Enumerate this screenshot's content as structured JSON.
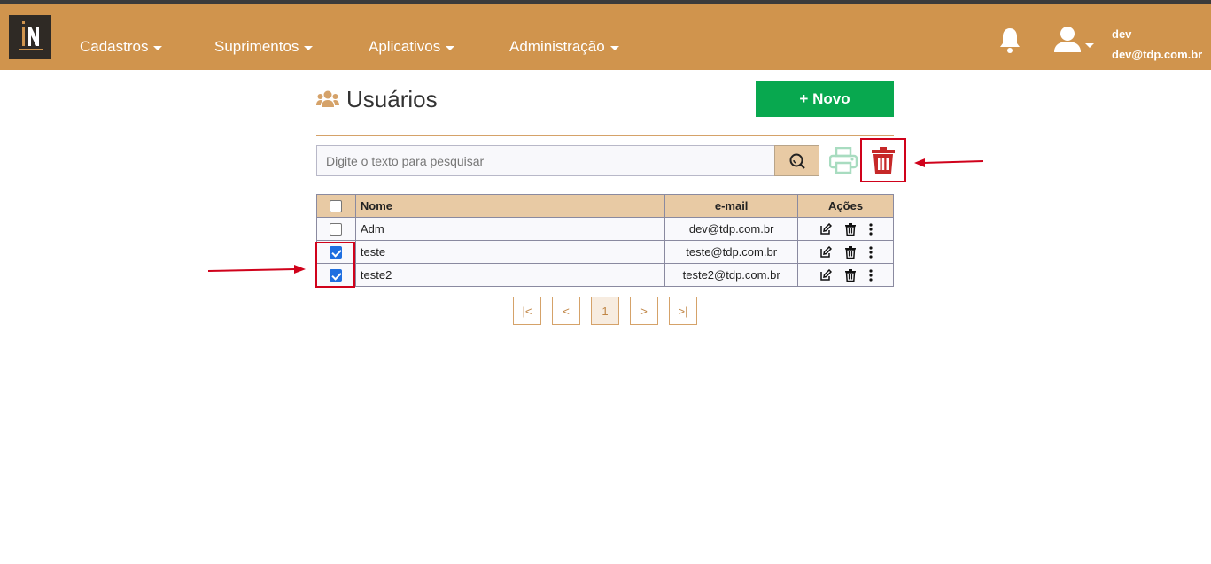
{
  "nav": {
    "logo_text": "IN",
    "menus": [
      "Cadastros",
      "Suprimentos",
      "Aplicativos",
      "Administração"
    ],
    "user": {
      "name": "dev",
      "email": "dev@tdp.com.br"
    }
  },
  "page": {
    "title": "Usuários",
    "new_button": "+ Novo",
    "search_placeholder": "Digite o texto para pesquisar"
  },
  "table": {
    "headers": {
      "name": "Nome",
      "email": "e-mail",
      "actions": "Ações"
    },
    "rows": [
      {
        "name": "Adm",
        "email": "dev@tdp.com.br",
        "checked": false
      },
      {
        "name": "teste",
        "email": "teste@tdp.com.br",
        "checked": true
      },
      {
        "name": "teste2",
        "email": "teste2@tdp.com.br",
        "checked": true
      }
    ]
  },
  "pagination": {
    "first": "|<",
    "prev": "<",
    "current": "1",
    "next": ">",
    "last": ">|"
  },
  "colors": {
    "navbar": "#d0944d",
    "accent_green": "#08a84f",
    "delete_red": "#c62828",
    "annotation_red": "#d0021b"
  }
}
